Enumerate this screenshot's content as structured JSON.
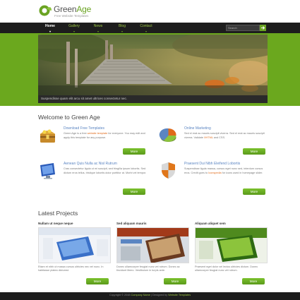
{
  "brand": {
    "name_plain": "Green",
    "name_accent": "Age",
    "tagline": "Free Website Templates"
  },
  "nav": {
    "items": [
      {
        "label": "Home",
        "active": true
      },
      {
        "label": "Gallery",
        "active": false
      },
      {
        "label": "News",
        "active": false
      },
      {
        "label": "Blog",
        "active": false
      },
      {
        "label": "Contact",
        "active": false
      }
    ],
    "search_placeholder": "Search"
  },
  "hero": {
    "caption": "Suspendisse quam elit arcu sit amet ultrices consectetur nec."
  },
  "welcome": {
    "title": "Welcome to Green Age",
    "features": [
      {
        "icon": "treasure-chest-icon",
        "title": "Download Free Templates",
        "text_a": "Green Age is a free ",
        "link": "website template",
        "text_b": " for everyone. You may edit and apply this template for any purpose.",
        "more": "More"
      },
      {
        "icon": "pie-chart-icon",
        "title": "Online Marketing",
        "text_a": "Sed el erat ac mauris suscipit viverra. Sed el erat ac mauris suscipit viverra. Validate ",
        "link": "XHTML",
        "text_b": " and CSS.",
        "more": "More"
      },
      {
        "icon": "monitor-icon",
        "title": "Aenean Quis Nulla ac Nisl Rutrum",
        "text_a": "Cras consectetur ligula ut mi suscipit, sed fringilla ipsum lobortis. Sed dictum eros tellus, tristique lobortis dolor porttitor at. Morbi vel tempor.",
        "link": "",
        "text_b": "",
        "more": "More"
      },
      {
        "icon": "shield-icon",
        "title": "Praesent Dui Nibh Eleifend Lobortis",
        "text_a": "Suspendisse ligula massa, cursus eget nunc sed, interdum cursus eros. Credit goes to ",
        "link": "Iconspedia",
        "text_b": " for icons used in homepage slider.",
        "more": "More"
      }
    ]
  },
  "projects": {
    "title": "Latest Projects",
    "items": [
      {
        "title": "Nullam ut neque neque",
        "text_a": "Etiam et nibh ut massa cursus ultricies nec vel nunc. In habitasse platea dictumst.",
        "link": "",
        "more": "More"
      },
      {
        "title": "Sed aliquam mauris",
        "text_a": "Donec ullamcorper feugiat nunc vel rutrum. Donec ac tincidunt libero. Vestibulum in turpis ante.",
        "link": "",
        "more": "More"
      },
      {
        "title": "Aliquam aliquet sem",
        "text_a": "Praesent eget dolor vel lectus ultricies dictum. Donec ullamcorper feugiat nunc vel rutrum.",
        "link": "",
        "more": "More"
      }
    ]
  },
  "footer": {
    "text_a": "Copyright © 2048 ",
    "link_a": "Company Name",
    "text_b": " | Designed by ",
    "link_b": "Website Templates"
  },
  "colors": {
    "accent_green": "#6ba81e",
    "nav_bg": "#1d1d1d",
    "link_blue": "#5b85c2",
    "highlight_orange": "#e06a1a"
  }
}
